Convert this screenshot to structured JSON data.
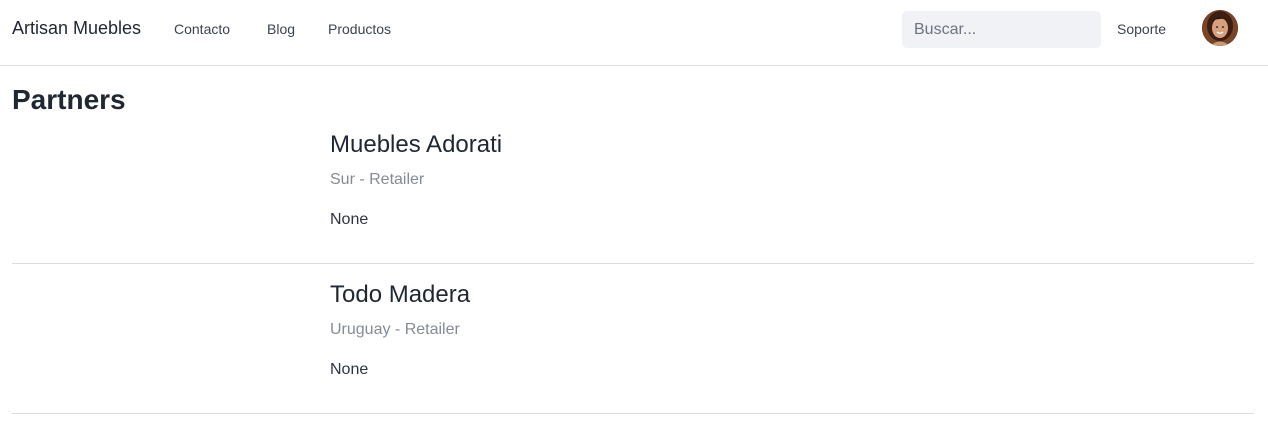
{
  "navbar": {
    "brand": "Artisan Muebles",
    "links": [
      {
        "label": "Contacto"
      },
      {
        "label": "Blog"
      },
      {
        "label": "Productos"
      }
    ],
    "search": {
      "placeholder": "Buscar...",
      "value": ""
    },
    "support_label": "Soporte"
  },
  "main": {
    "title": "Partners",
    "partners": [
      {
        "name": "Muebles Adorati",
        "meta": "Sur - Retailer",
        "description": "None"
      },
      {
        "name": "Todo Madera",
        "meta": "Uruguay - Retailer",
        "description": "None"
      }
    ]
  }
}
